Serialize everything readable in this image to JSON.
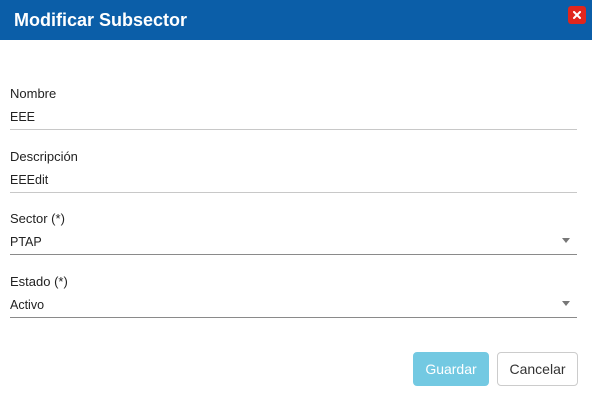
{
  "dialog": {
    "title": "Modificar Subsector",
    "close_icon": "close-icon"
  },
  "form": {
    "nombre": {
      "label": "Nombre",
      "value": "EEE"
    },
    "descripcion": {
      "label": "Descripción",
      "value": "EEEdit"
    },
    "sector": {
      "label": "Sector (*)",
      "value": "PTAP"
    },
    "estado": {
      "label": "Estado (*)",
      "value": "Activo"
    }
  },
  "actions": {
    "save_label": "Guardar",
    "cancel_label": "Cancelar"
  },
  "colors": {
    "titlebar": "#0b5ea8",
    "close": "#e0261c",
    "save_button": "#5bc0de"
  }
}
